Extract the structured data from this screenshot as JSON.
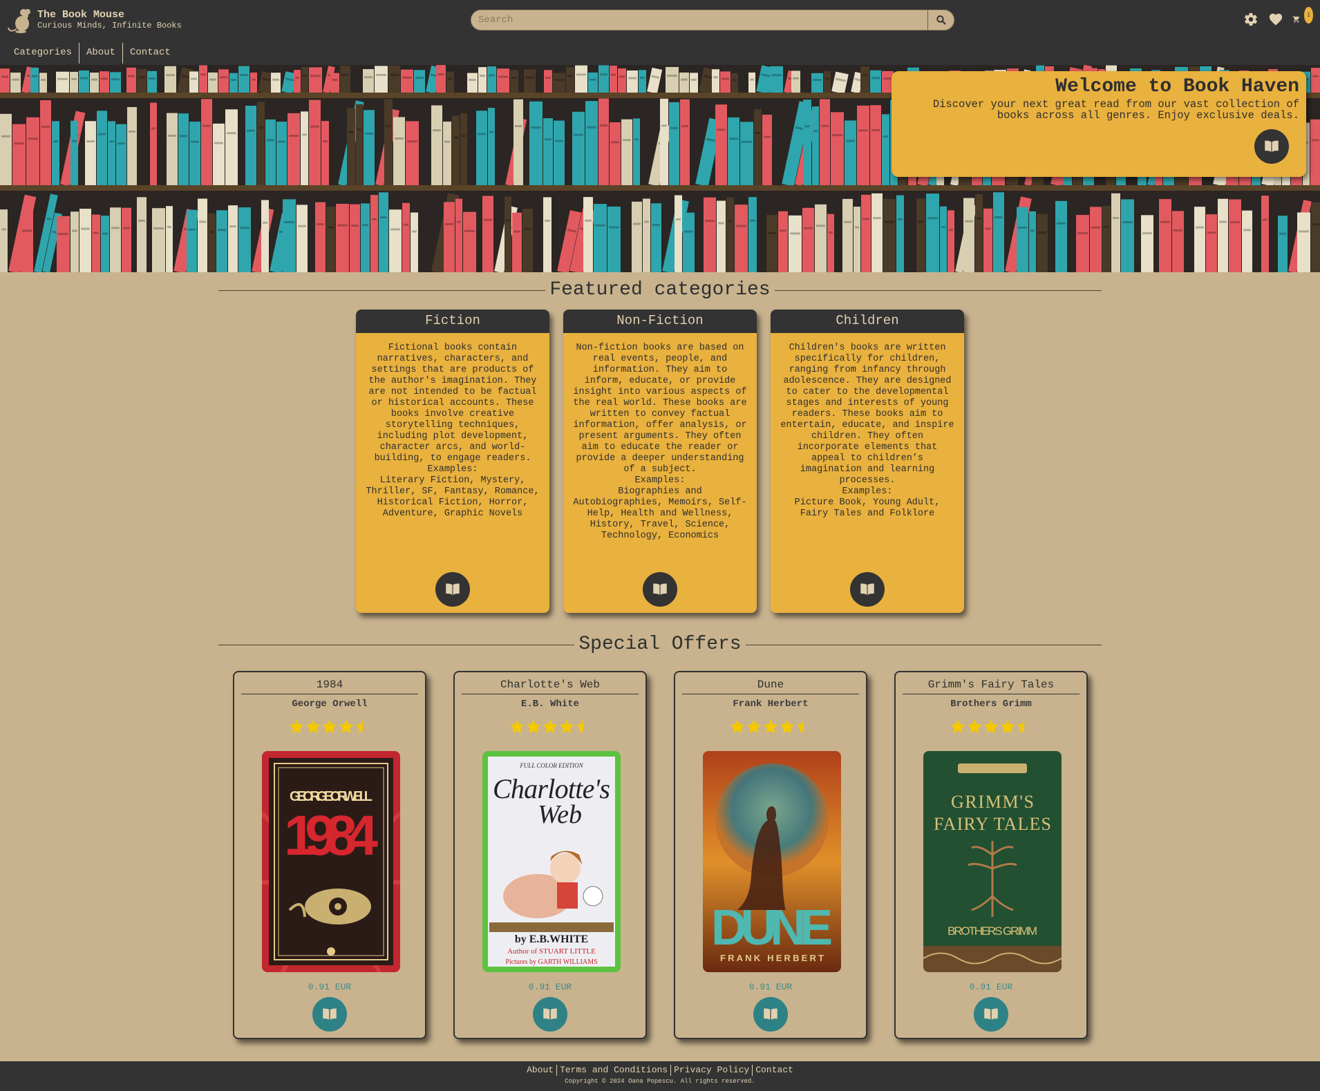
{
  "brand": {
    "title": "The Book Mouse",
    "subtitle": "Curious Minds, Infinite Books"
  },
  "search": {
    "placeholder": "Search"
  },
  "header_icons": {
    "settings": "gear-icon",
    "wishlist": "heart-icon",
    "cart": "cart-icon",
    "cart_count": "1"
  },
  "nav": {
    "items": [
      "Categories",
      "About",
      "Contact"
    ]
  },
  "hero": {
    "title": "Welcome to Book Haven",
    "text": "Discover your next great read from our vast collection of books across all genres. Enjoy exclusive deals."
  },
  "featured": {
    "heading": "Featured categories",
    "categories": [
      {
        "name": "Fiction",
        "description": "Fictional books contain narratives, characters, and settings that are products of the author's imagination. They are not intended to be factual or historical accounts. These books involve creative storytelling techniques, including plot development, character arcs, and world-building, to engage readers.",
        "examples_label": "Examples:",
        "examples": "Literary Fiction, Mystery, Thriller, SF, Fantasy, Romance, Historical Fiction, Horror, Adventure, Graphic Novels"
      },
      {
        "name": "Non-Fiction",
        "description": "Non-fiction books are based on real events, people, and information. They aim to inform, educate, or provide insight into various aspects of the real world. These books are written to convey factual information, offer analysis, or present arguments. They often aim to educate the reader or provide a deeper understanding of a subject.",
        "examples_label": "Examples:",
        "examples": "Biographies and Autobiographies, Memoirs, Self-Help, Health and Wellness, History, Travel, Science, Technology, Economics"
      },
      {
        "name": "Children",
        "description": "Children's books are written specifically for children, ranging from infancy through adolescence. They are designed to cater to the developmental stages and interests of young readers. These books aim to entertain, educate, and inspire children. They often incorporate elements that appeal to children’s imagination and learning processes.",
        "examples_label": "Examples:",
        "examples": "Picture Book, Young Adult, Fairy Tales and Folklore"
      }
    ]
  },
  "offers": {
    "heading": "Special Offers",
    "books": [
      {
        "title": "1984",
        "author": "George Orwell",
        "rating": 4.5,
        "price": "0.91 EUR",
        "cover": {
          "lines": [
            "GEORGE ORWELL",
            "1984"
          ]
        }
      },
      {
        "title": "Charlotte's Web",
        "author": "E.B. White",
        "rating": 4.5,
        "price": "0.91 EUR",
        "cover": {
          "lines": [
            "FULL COLOR EDITION",
            "Charlotte's",
            "Web",
            "by E.B.WHITE",
            "Author of STUART LITTLE",
            "Pictures by GARTH WILLIAMS"
          ]
        }
      },
      {
        "title": "Dune",
        "author": "Frank Herbert",
        "rating": 4.5,
        "price": "0.91 EUR",
        "cover": {
          "lines": [
            "DUNE",
            "FRANK HERBERT"
          ]
        }
      },
      {
        "title": "Grimm's Fairy Tales",
        "author": "Brothers Grimm",
        "rating": 4.5,
        "price": "0.91 EUR",
        "cover": {
          "lines": [
            "GRIMM'S",
            "FAIRY TALES",
            "BROTHERS GRIMM"
          ]
        }
      }
    ]
  },
  "footer": {
    "links": [
      "About",
      "Terms and Conditions",
      "Privacy Policy",
      "Contact"
    ],
    "copyright": "Copyright © 2024 Oana Popescu. All rights reserved."
  },
  "colors": {
    "dark": "#333333",
    "page": "#c8b38e",
    "accent": "#e9b13e",
    "teal": "#2e8285",
    "star": "#f5c800"
  }
}
